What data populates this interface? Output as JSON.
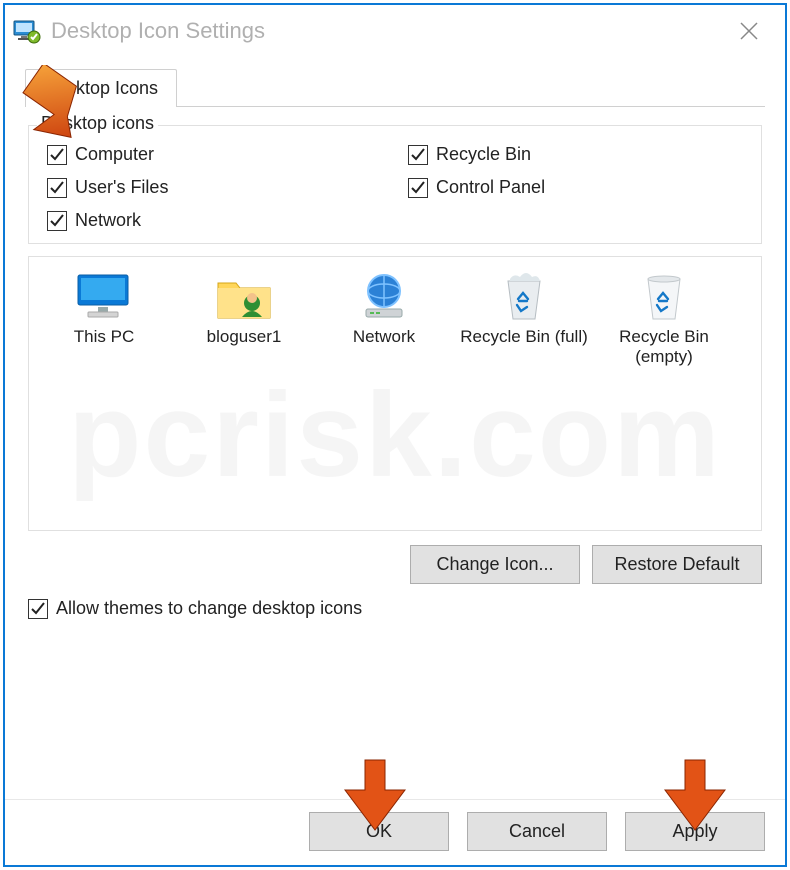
{
  "window": {
    "title": "Desktop Icon Settings"
  },
  "tabs": {
    "main": "Desktop Icons"
  },
  "group": {
    "caption": "Desktop icons",
    "checks": {
      "computer": "Computer",
      "users_files": "User's Files",
      "network": "Network",
      "recycle_bin": "Recycle Bin",
      "control_panel": "Control Panel"
    }
  },
  "icons": {
    "this_pc": "This PC",
    "user": "bloguser1",
    "network": "Network",
    "recycle_full": "Recycle Bin (full)",
    "recycle_empty": "Recycle Bin (empty)"
  },
  "buttons": {
    "change_icon": "Change Icon...",
    "restore_default": "Restore Default",
    "ok": "OK",
    "cancel": "Cancel",
    "apply": "Apply"
  },
  "allow_themes": "Allow themes to change desktop icons",
  "watermark": "pcrisk.com",
  "checked_states": {
    "computer": true,
    "users_files": true,
    "network": true,
    "recycle_bin": true,
    "control_panel": true,
    "allow_themes": true
  }
}
